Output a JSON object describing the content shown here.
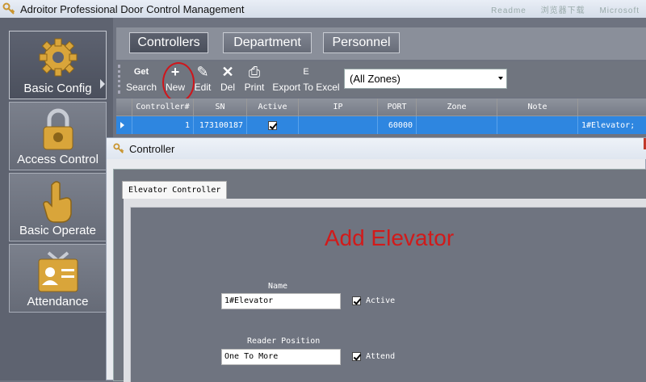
{
  "window": {
    "title": "Adroitor Professional Door Control Management",
    "blurred_right": [
      "Readme",
      "浏览器下载",
      "Microsoft"
    ]
  },
  "sidebar": {
    "items": [
      {
        "label": "Basic Config",
        "icon": "gear-icon"
      },
      {
        "label": "Access Control",
        "icon": "padlock-icon"
      },
      {
        "label": "Basic Operate",
        "icon": "hand-pointer-icon"
      },
      {
        "label": "Attendance",
        "icon": "id-badge-icon"
      }
    ]
  },
  "tabs": [
    {
      "label": "Controllers"
    },
    {
      "label": "Department"
    },
    {
      "label": "Personnel"
    }
  ],
  "toolbar": {
    "search": {
      "label": "Search",
      "glyph": "Get"
    },
    "new": {
      "label": "New",
      "glyph": "+"
    },
    "edit": {
      "label": "Edit",
      "glyph": "✎"
    },
    "del": {
      "label": "Del",
      "glyph": "✕"
    },
    "print": {
      "label": "Print",
      "glyph": "⎙"
    },
    "export": {
      "label": "Export To Excel",
      "glyph": "E"
    },
    "zones": "(All Zones)"
  },
  "grid": {
    "columns": [
      "Controller#",
      "SN",
      "Active",
      "IP",
      "PORT",
      "Zone",
      "Note"
    ],
    "row": {
      "controller": "1",
      "sn": "173100187",
      "ip": "",
      "port": "60000",
      "zone": "",
      "note": "",
      "extra": "1#Elevator;"
    }
  },
  "dialog": {
    "title": "Controller",
    "tab": "Elevator Controller",
    "heading": "Add Elevator",
    "name_label": "Name",
    "name_value": "1#Elevator",
    "active_label": "Active",
    "reader_label": "Reader Position",
    "reader_value": "One To More",
    "attend_label": "Attend"
  },
  "colors": {
    "highlight": "#2e86e0",
    "heading": "#d11a1a",
    "circle": "#d0151b"
  }
}
